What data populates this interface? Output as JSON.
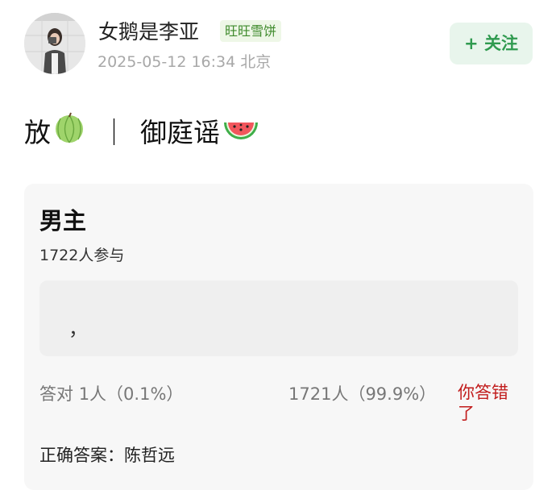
{
  "post": {
    "author_name": "女鹅是李亚",
    "author_badge": "旺旺雪饼",
    "meta_time": "2025-05-12 16:34",
    "meta_location": "北京",
    "follow_label": "+ 关注",
    "title_prefix": "放",
    "title_separator": "｜",
    "title_text": "御庭谣",
    "icons": [
      "melon-icon",
      "watermelon-icon"
    ]
  },
  "poll": {
    "question": "男主",
    "participants": "1722人参与",
    "option_text": "，",
    "result_correct_label": "答对",
    "result_correct_value": "1人（0.1%）",
    "result_other_value": "1721人（99.9%）",
    "result_status": "你答错了",
    "correct_answer": "正确答案：陈哲远"
  }
}
